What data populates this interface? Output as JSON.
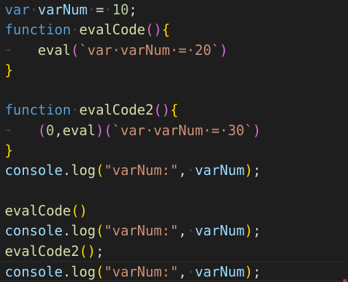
{
  "editor": {
    "language": "javascript",
    "colors": {
      "background": "#1e1e1e",
      "keyword": "#569cd6",
      "variable": "#9cdcfe",
      "function": "#dcdcaa",
      "number": "#b5cea8",
      "string": "#ce9178",
      "bracket_level1": "#ffd700",
      "bracket_level2": "#da70d6",
      "whitespace_marker": "#4a4a4a"
    },
    "lines": [
      {
        "tokens": [
          {
            "t": "var",
            "c": "kw"
          },
          {
            "t": "·",
            "c": "ws"
          },
          {
            "t": "varNum",
            "c": "var"
          },
          {
            "t": "·",
            "c": "ws"
          },
          {
            "t": "=",
            "c": "op"
          },
          {
            "t": "·",
            "c": "ws"
          },
          {
            "t": "10",
            "c": "num"
          },
          {
            "t": ";",
            "c": "pun"
          }
        ]
      },
      {
        "tokens": [
          {
            "t": "function",
            "c": "kw"
          },
          {
            "t": "·",
            "c": "ws"
          },
          {
            "t": "evalCode",
            "c": "fn"
          },
          {
            "t": "()",
            "c": "br2"
          },
          {
            "t": "{",
            "c": "br1"
          }
        ]
      },
      {
        "indent": true,
        "tokens": [
          {
            "t": "eval",
            "c": "fn"
          },
          {
            "t": "(",
            "c": "br2"
          },
          {
            "t": "`var·varNum·=·20`",
            "c": "str"
          },
          {
            "t": ")",
            "c": "br2"
          }
        ]
      },
      {
        "tokens": [
          {
            "t": "}",
            "c": "br1"
          }
        ]
      },
      {
        "tokens": []
      },
      {
        "tokens": [
          {
            "t": "function",
            "c": "kw"
          },
          {
            "t": "·",
            "c": "ws"
          },
          {
            "t": "evalCode2",
            "c": "fn"
          },
          {
            "t": "()",
            "c": "br2"
          },
          {
            "t": "{",
            "c": "br1"
          }
        ]
      },
      {
        "indent": true,
        "tokens": [
          {
            "t": "(",
            "c": "br2"
          },
          {
            "t": "0",
            "c": "num"
          },
          {
            "t": ",",
            "c": "pun"
          },
          {
            "t": "eval",
            "c": "fn"
          },
          {
            "t": ")",
            "c": "br2"
          },
          {
            "t": "(",
            "c": "br2"
          },
          {
            "t": "`var·varNum·=·30`",
            "c": "str"
          },
          {
            "t": ")",
            "c": "br2"
          }
        ]
      },
      {
        "tokens": [
          {
            "t": "}",
            "c": "br1"
          }
        ]
      },
      {
        "tokens": [
          {
            "t": "console",
            "c": "var"
          },
          {
            "t": ".",
            "c": "pun"
          },
          {
            "t": "log",
            "c": "fn"
          },
          {
            "t": "(",
            "c": "br1"
          },
          {
            "t": "\"varNum:\"",
            "c": "str"
          },
          {
            "t": ",",
            "c": "pun"
          },
          {
            "t": "·",
            "c": "ws"
          },
          {
            "t": "varNum",
            "c": "var"
          },
          {
            "t": ")",
            "c": "br1"
          },
          {
            "t": ";",
            "c": "pun"
          }
        ]
      },
      {
        "tokens": []
      },
      {
        "tokens": [
          {
            "t": "evalCode",
            "c": "fn"
          },
          {
            "t": "()",
            "c": "br1"
          }
        ]
      },
      {
        "tokens": [
          {
            "t": "console",
            "c": "var"
          },
          {
            "t": ".",
            "c": "pun"
          },
          {
            "t": "log",
            "c": "fn"
          },
          {
            "t": "(",
            "c": "br1"
          },
          {
            "t": "\"varNum:\"",
            "c": "str"
          },
          {
            "t": ",",
            "c": "pun"
          },
          {
            "t": "·",
            "c": "ws"
          },
          {
            "t": "varNum",
            "c": "var"
          },
          {
            "t": ")",
            "c": "br1"
          },
          {
            "t": ";",
            "c": "pun"
          }
        ]
      },
      {
        "tokens": [
          {
            "t": "evalCode2",
            "c": "fn"
          },
          {
            "t": "()",
            "c": "br1"
          },
          {
            "t": ";",
            "c": "pun"
          }
        ]
      },
      {
        "current": true,
        "tokens": [
          {
            "t": "console",
            "c": "var"
          },
          {
            "t": ".",
            "c": "pun"
          },
          {
            "t": "log",
            "c": "fn"
          },
          {
            "t": "(",
            "c": "br1"
          },
          {
            "t": "\"varNum:\"",
            "c": "str"
          },
          {
            "t": ",",
            "c": "pun"
          },
          {
            "t": "·",
            "c": "ws"
          },
          {
            "t": "varNum",
            "c": "var"
          },
          {
            "t": ")",
            "c": "br1"
          },
          {
            "t": ";",
            "c": "pun"
          }
        ]
      }
    ],
    "indent_glyph": "→"
  }
}
